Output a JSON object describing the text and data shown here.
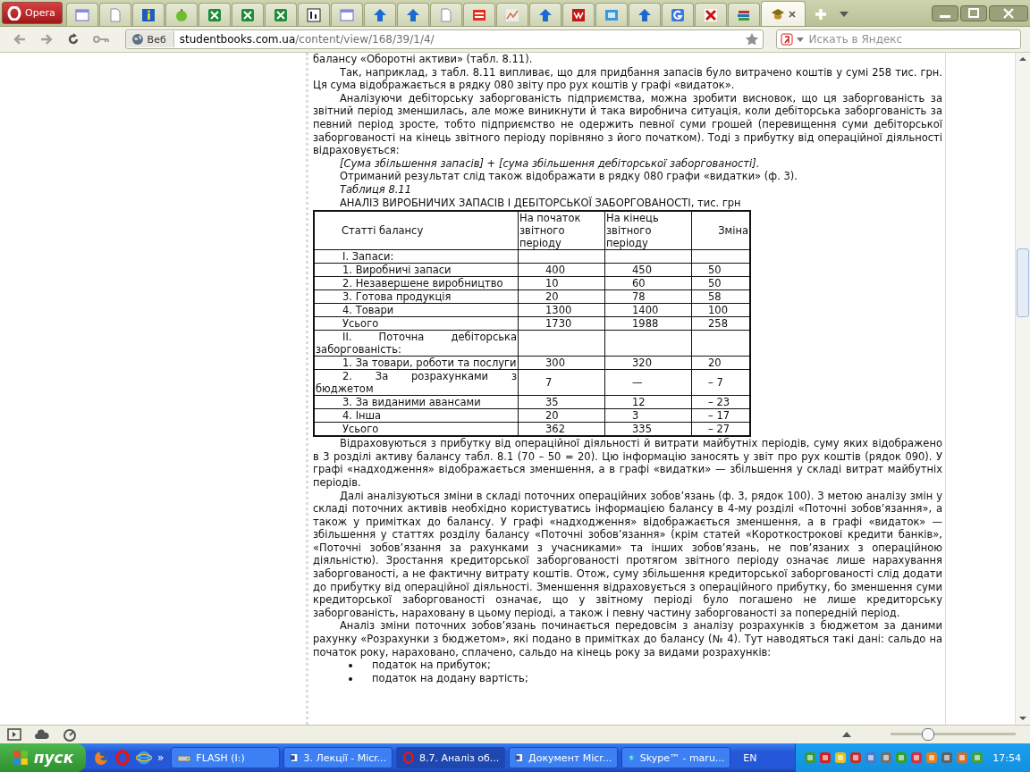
{
  "browser": {
    "menu_button": "Opera",
    "tabs": [
      {
        "selected": false
      },
      {
        "selected": false
      },
      {
        "selected": false
      },
      {
        "selected": false
      },
      {
        "selected": false
      },
      {
        "selected": false
      },
      {
        "selected": false
      },
      {
        "selected": false
      },
      {
        "selected": false
      },
      {
        "selected": false
      },
      {
        "selected": false
      },
      {
        "selected": false
      },
      {
        "selected": false
      },
      {
        "selected": false
      },
      {
        "selected": false
      },
      {
        "selected": false
      },
      {
        "selected": false
      },
      {
        "selected": false
      },
      {
        "selected": false
      },
      {
        "selected": false
      },
      {
        "selected": false
      },
      {
        "selected": true
      }
    ]
  },
  "address_bar": {
    "site_badge": "Веб",
    "url_host": "studentbooks.com.ua",
    "url_path": "/content/view/168/39/1/4/",
    "search": {
      "placeholder": "Искать в Яндекс"
    }
  },
  "article": {
    "blocks": [
      {
        "kind": "cont",
        "text": "балансу «Оборотні активи» (табл. 8.11)."
      },
      {
        "kind": "para",
        "text": "Так, наприклад, з табл. 8.11 випливає, що для придбання запасів було витрачено коштів у сумі 258 тис. грн. Ця сума відображається в рядку 080 звіту про рух коштів у графі «видаток»."
      },
      {
        "kind": "para",
        "text": "Аналізуючи дебіторську заборгованість підприємства, можна зробити висновок, що ця заборгованість за звітний період зменшилась, але може виникнути й така виробнича ситуація, коли дебіторська заборгованість за певний період зросте, тобто підприємство не одержить певної суми грошей (перевищення суми дебіторської заборгованості на кінець звітного періоду порівняно з його початком). Тоді з прибутку від операційної діяльності відраховується:"
      },
      {
        "kind": "italic",
        "text": "[Сума збільшення запасів] + [сума збільшення дебіторської заборгованості]."
      },
      {
        "kind": "para",
        "text": "Отриманий результат слід також відображати в рядку 080 графи «видатки» (ф. 3)."
      },
      {
        "kind": "italic",
        "text": "Таблиця 8.11"
      },
      {
        "kind": "para",
        "text": "АНАЛІЗ ВИРОБНИЧИХ ЗАПАСІВ І ДЕБІТОРСЬКОЇ ЗАБОРГОВАНОСТІ, тис. грн"
      },
      {
        "kind": "table",
        "columns": [
          "Статті балансу",
          "На початок звітного періоду",
          "На кінець звітного періоду",
          "Зміна"
        ],
        "rows": [
          {
            "kind": "section",
            "label": "I. Запаси:"
          },
          {
            "kind": "item",
            "label": "1. Виробничі запаси",
            "cells": [
              "400",
              "450",
              "50"
            ]
          },
          {
            "kind": "item",
            "label": "2. Незавершене виробництво",
            "cells": [
              "10",
              "60",
              "50"
            ]
          },
          {
            "kind": "item",
            "label": "3. Готова продукція",
            "cells": [
              "20",
              "78",
              "58"
            ]
          },
          {
            "kind": "item",
            "label": "4. Товари",
            "cells": [
              "1300",
              "1400",
              "100"
            ]
          },
          {
            "kind": "item",
            "label": "Усього",
            "cells": [
              "1730",
              "1988",
              "258"
            ]
          },
          {
            "kind": "section",
            "label": "II. Поточна дебіторська заборгованість:"
          },
          {
            "kind": "item",
            "label": "1. За товари, роботи та послуги",
            "cells": [
              "300",
              "320",
              "20"
            ]
          },
          {
            "kind": "item",
            "label": "2. За розрахунками з бюджетом",
            "cells": [
              "7",
              "—",
              "– 7"
            ]
          },
          {
            "kind": "item",
            "label": "3. За виданими авансами",
            "cells": [
              "35",
              "12",
              "– 23"
            ]
          },
          {
            "kind": "item",
            "label": "4. Інша",
            "cells": [
              "20",
              "3",
              "– 17"
            ]
          },
          {
            "kind": "item",
            "label": "Усього",
            "cells": [
              "362",
              "335",
              "– 27"
            ]
          }
        ]
      },
      {
        "kind": "para",
        "text": "Відраховуються з прибутку від операційної діяльності й витрати майбутніх періодів, суму яких відображено в 3 розділі активу балансу табл. 8.1 (70 – 50 = 20). Цю інформацію заносять у звіт про рух коштів (рядок 090). У графі «надходження» відображається зменшення, а в графі «видатки» — збільшення у складі витрат майбутніх періодів."
      },
      {
        "kind": "para",
        "text": "Далі аналізуються зміни в складі поточних операційних зобов’язань (ф. 3, рядок 100). З метою аналізу змін у складі поточних активів необхідно користуватись інформацією балансу в 4-му розділі «Поточні зобов’язання», а також у примітках до балансу. У графі «надходження» відображається зменшення, а в графі «видаток» — збільшення у статтях розділу балансу «Поточні зобов’язання» (крім статей «Короткострокові кредити банків», «Поточні зобов’язання за рахунками з учасниками» та інших зобов’язань, не пов’язаних з операційною діяльністю). Зростання кредиторської заборгованості протягом звітного періоду означає лише нарахування заборгованості, а не фактичну витрату коштів. Отож, суму збільшення кредиторської заборгованості слід додати до прибутку від операційної діяльності. Зменшення відраховується з операційного прибутку, бо зменшення суми кредиторської заборгованості означає, що у звітному періоді було погашено не лише кредиторську заборгованість, нараховану в цьому періоді, а також і певну частину заборгованості за попередній період."
      },
      {
        "kind": "para",
        "text": "Аналіз зміни поточних зобов’язань починається передовсім з аналізу розрахунків з бюджетом за даними рахунку «Розрахунки з бюджетом», які подано в примітках до балансу (№ 4). Тут наводяться такі дані: сальдо на початок року, нараховано, сплачено, сальдо на кінець року за видами розрахунків:"
      },
      {
        "kind": "bullet",
        "text": "податок на прибуток;"
      },
      {
        "kind": "bullet",
        "text": "податок на додану вартість;"
      }
    ]
  },
  "status_bar": {
    "zoom_slider": {
      "level": 0.3
    }
  },
  "taskbar": {
    "start": "пуск",
    "more": "»",
    "tasks": [
      {
        "label": "FLASH (I:)",
        "selected": false
      },
      {
        "label": "3. Лекції - Micr...",
        "selected": false
      },
      {
        "label": "8.7. Аналіз об...",
        "selected": true
      },
      {
        "label": "Документ Micr...",
        "selected": false
      },
      {
        "label": "Skype™ - maru...",
        "selected": false
      }
    ],
    "language": "EN",
    "clock": "17:54"
  }
}
